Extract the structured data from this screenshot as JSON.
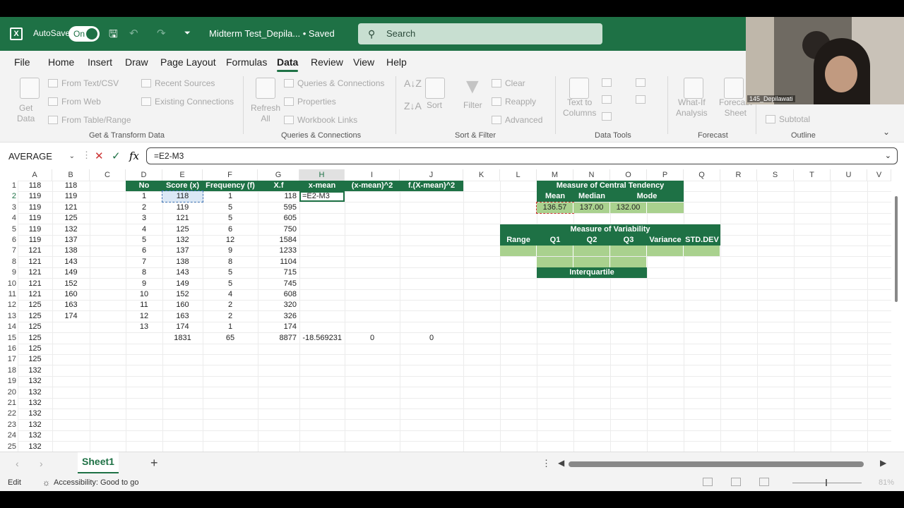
{
  "titlebar": {
    "autosave_label": "AutoSave",
    "autosave_state": "On",
    "document_title": "Midterm Test_Depila...  •  Saved",
    "search_placeholder": "Search"
  },
  "menu": [
    "File",
    "Home",
    "Insert",
    "Draw",
    "Page Layout",
    "Formulas",
    "Data",
    "Review",
    "View",
    "Help"
  ],
  "active_menu": "Data",
  "ribbon": {
    "get_data": "Get\nData",
    "from_text_csv": "From Text/CSV",
    "from_web": "From Web",
    "from_table_range": "From Table/Range",
    "recent_sources": "Recent Sources",
    "existing_connections": "Existing Connections",
    "group_get_transform": "Get & Transform Data",
    "refresh_all": "Refresh\nAll",
    "queries_connections": "Queries & Connections",
    "properties": "Properties",
    "workbook_links": "Workbook Links",
    "group_queries": "Queries & Connections",
    "sort": "Sort",
    "filter": "Filter",
    "clear": "Clear",
    "reapply": "Reapply",
    "advanced": "Advanced",
    "group_sort_filter": "Sort & Filter",
    "text_to_columns": "Text to\nColumns",
    "group_data_tools": "Data Tools",
    "what_if": "What-If\nAnalysis",
    "forecast_sheet": "Forecast\nSheet",
    "group_forecast": "Forecast",
    "subtotal": "Subtotal",
    "group_outline": "Outline"
  },
  "formula_bar": {
    "name_box": "AVERAGE",
    "formula": "=E2-M3"
  },
  "columns": [
    "A",
    "B",
    "C",
    "D",
    "E",
    "F",
    "G",
    "H",
    "I",
    "J",
    "K",
    "L",
    "M",
    "N",
    "O",
    "P",
    "Q",
    "R",
    "S",
    "T",
    "U",
    "V"
  ],
  "rows": [
    "1",
    "2",
    "3",
    "4",
    "5",
    "6",
    "7",
    "8",
    "9",
    "10",
    "11",
    "12",
    "13",
    "14",
    "15",
    "16",
    "17",
    "18",
    "19",
    "20",
    "21",
    "22",
    "23",
    "24",
    "25"
  ],
  "col_a": [
    "118",
    "119",
    "119",
    "119",
    "119",
    "119",
    "121",
    "121",
    "121",
    "121",
    "121",
    "125",
    "125",
    "125",
    "125",
    "125",
    "125",
    "132",
    "132",
    "132",
    "132",
    "132",
    "132",
    "132",
    "132"
  ],
  "col_b": [
    "118",
    "119",
    "121",
    "125",
    "132",
    "137",
    "138",
    "143",
    "149",
    "152",
    "160",
    "163",
    "174"
  ],
  "table": {
    "headers": [
      "No",
      "Score (x)",
      "Frequency (f)",
      "X.f",
      "x-mean",
      "(x-mean)^2",
      "f.(X-mean)^2"
    ],
    "no": [
      "1",
      "2",
      "3",
      "4",
      "5",
      "6",
      "7",
      "8",
      "9",
      "10",
      "11",
      "12",
      "13"
    ],
    "score": [
      "118",
      "119",
      "121",
      "125",
      "132",
      "137",
      "138",
      "143",
      "149",
      "152",
      "160",
      "163",
      "174"
    ],
    "freq": [
      "1",
      "5",
      "5",
      "6",
      "12",
      "9",
      "8",
      "5",
      "5",
      "4",
      "2",
      "2",
      "1"
    ],
    "xf": [
      "118",
      "595",
      "605",
      "750",
      "1584",
      "1233",
      "1104",
      "715",
      "745",
      "608",
      "320",
      "326",
      "174"
    ],
    "editing_cell": "=E2-M3",
    "totals": {
      "score": "1831",
      "freq": "65",
      "xf": "8877",
      "xmean": "-18.569231",
      "sq": "0",
      "fsq": "0"
    }
  },
  "central_tendency": {
    "title": "Measure of Central Tendency",
    "headers": [
      "Mean",
      "Median",
      "Mode"
    ],
    "values": [
      "136.57",
      "137.00",
      "132.00"
    ]
  },
  "variability": {
    "title": "Measure of Variability",
    "headers": [
      "Range",
      "Q1",
      "Q2",
      "Q3",
      "Variance",
      "STD.DEV"
    ],
    "interquartile": "Interquartile"
  },
  "sheet_tab": "Sheet1",
  "status": {
    "mode": "Edit",
    "accessibility": "Accessibility: Good to go",
    "zoom": "81%"
  },
  "webcam": {
    "caption": "145_Depilawati"
  },
  "colors": {
    "excel_green": "#1e7145",
    "light_green": "#a9d18e"
  }
}
